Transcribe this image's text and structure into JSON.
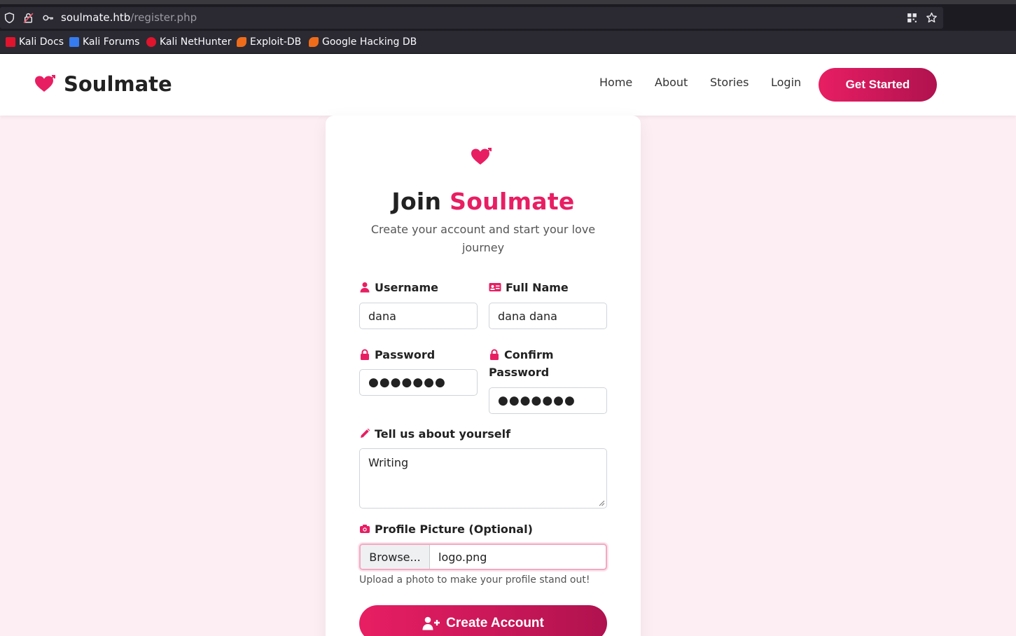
{
  "browser": {
    "url_host": "soulmate.htb",
    "url_path": "/register.php",
    "bookmarks": [
      {
        "label": "Kali Docs",
        "icon": "kali-docs-icon",
        "color": "#e0142d"
      },
      {
        "label": "Kali Forums",
        "icon": "kali-forums-icon",
        "color": "#367bf0"
      },
      {
        "label": "Kali NetHunter",
        "icon": "kali-nethunter-icon",
        "color": "#e0142d"
      },
      {
        "label": "Exploit-DB",
        "icon": "exploit-db-icon",
        "color": "#ef6c1a"
      },
      {
        "label": "Google Hacking DB",
        "icon": "ghdb-icon",
        "color": "#ef6c1a"
      }
    ]
  },
  "nav": {
    "brand": "Soulmate",
    "links": [
      "Home",
      "About",
      "Stories",
      "Login"
    ],
    "cta": "Get Started"
  },
  "form": {
    "title_prefix": "Join",
    "title_accent": "Soulmate",
    "subtitle": "Create your account and start your love journey",
    "username": {
      "label": "Username",
      "value": "dana",
      "icon": "user-icon"
    },
    "fullname": {
      "label": "Full Name",
      "value": "dana dana",
      "icon": "id-card-icon"
    },
    "password": {
      "label": "Password",
      "value": "●●●●●●●",
      "icon": "lock-icon"
    },
    "confirm": {
      "label": "Confirm Password",
      "value": "●●●●●●●",
      "icon": "lock-icon"
    },
    "bio": {
      "label": "Tell us about yourself",
      "value": "Writing",
      "icon": "pencil-icon"
    },
    "picture": {
      "label": "Profile Picture (Optional)",
      "browse": "Browse...",
      "filename": "logo.png",
      "help": "Upload a photo to make your profile stand out!",
      "icon": "camera-icon"
    },
    "submit": "Create Account"
  },
  "colors": {
    "accent": "#e81e63",
    "accent_dark": "#b0124f"
  }
}
